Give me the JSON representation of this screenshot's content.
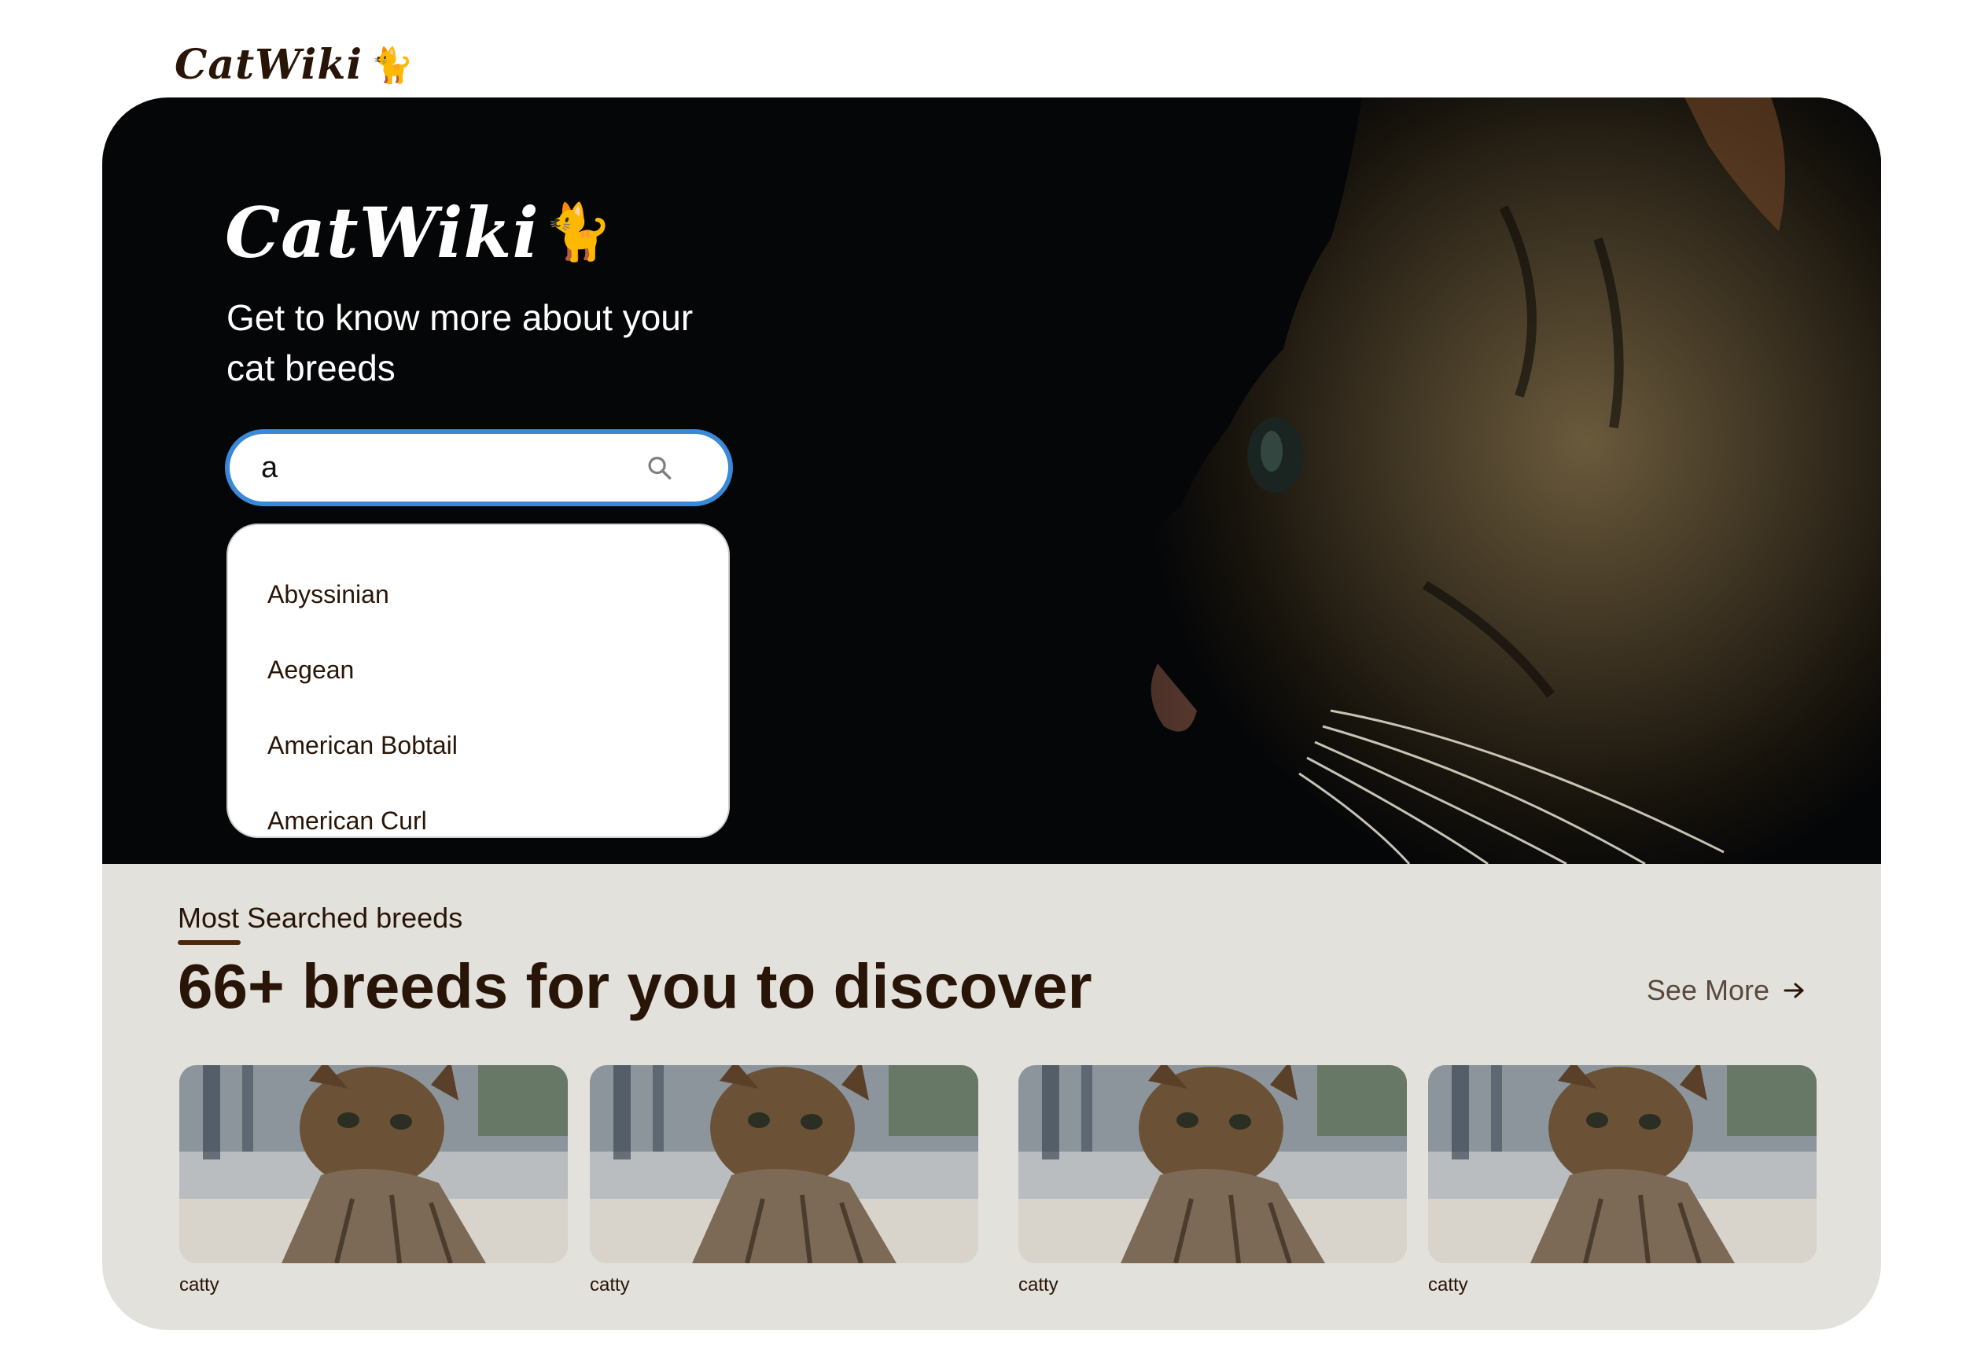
{
  "header": {
    "logo_text": "CatWiki",
    "logo_emoji": "🐈"
  },
  "hero": {
    "logo_text": "CatWiki",
    "logo_emoji": "🐈",
    "tagline": "Get to know more about your cat breeds"
  },
  "search": {
    "value": "a",
    "suggestions": [
      "Abyssinian",
      "Aegean",
      "American Bobtail",
      "American Curl"
    ]
  },
  "breeds_section": {
    "subheading": "Most Searched breeds",
    "heading": "66+ breeds for you to discover",
    "see_more": "See More",
    "cards": [
      {
        "name": "catty"
      },
      {
        "name": "catty"
      },
      {
        "name": "catty"
      },
      {
        "name": "catty"
      }
    ]
  },
  "colors": {
    "brand_dark": "#291507",
    "hero_bg": "#050608",
    "section_bg": "#e3e1dc",
    "focus_ring": "#3a88d8"
  },
  "icons": [
    "search-icon",
    "arrow-right-icon"
  ]
}
